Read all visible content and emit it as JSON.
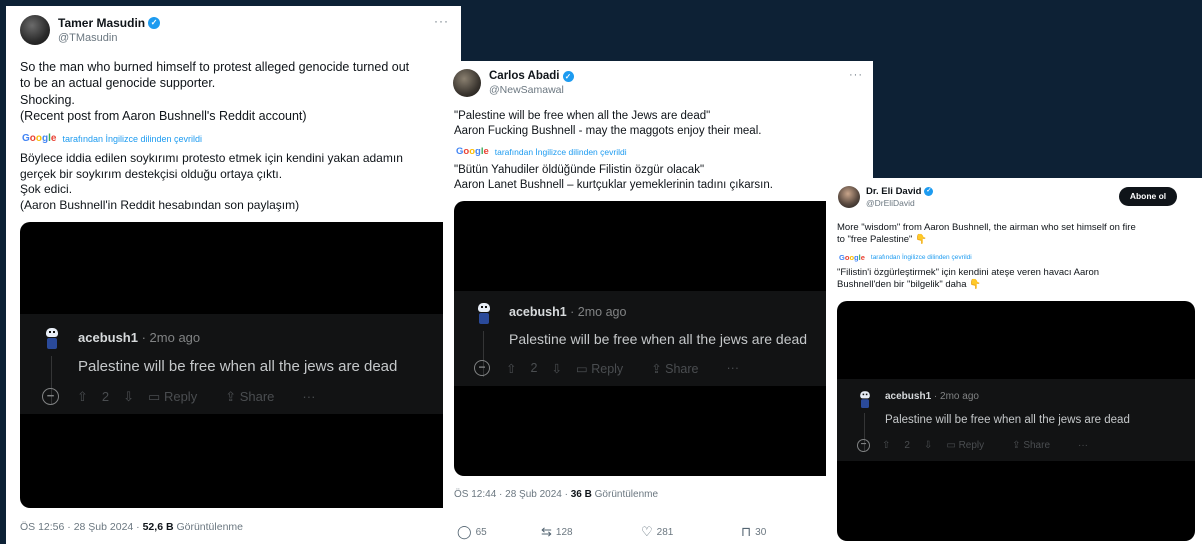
{
  "tweet1": {
    "author_name": "Tamer Masudin",
    "handle": "@TMasudin",
    "more": "···",
    "text_en": [
      "So the man who burned himself to protest alleged genocide turned out",
      "to be an actual genocide supporter.",
      "Shocking.",
      "(Recent post from Aaron Bushnell's Reddit account)"
    ],
    "translation_note": "tarafından İngilizce dilinden çevrildi",
    "text_tr": [
      "Böylece iddia edilen soykırımı protesto etmek için kendini yakan adamın",
      "gerçek bir soykırım destekçisi olduğu ortaya çıktı.",
      "Şok edici.",
      "(Aaron Bushnell'in Reddit hesabından son paylaşım)"
    ],
    "meta_prefix": "ÖS 12:56 · 28 Şub 2024 · ",
    "views": "52,6 B",
    "views_label": "Görüntülenme"
  },
  "tweet2": {
    "author_name": "Carlos Abadi",
    "handle": "@NewSamawal",
    "more": "···",
    "text_en": [
      "\"Palestine will be free when all the Jews are dead\"",
      "Aaron Fucking Bushnell - may the maggots enjoy their meal."
    ],
    "translation_note": "tarafından İngilizce dilinden çevrildi",
    "text_tr": [
      "\"Bütün Yahudiler öldüğünde Filistin özgür olacak\"",
      "Aaron Lanet Bushnell – kurtçuklar yemeklerinin tadını çıkarsın."
    ],
    "meta_prefix": "ÖS 12:44 · 28 Şub 2024 · ",
    "views": "36 B",
    "views_label": "Görüntülenme",
    "replies": "65",
    "reposts": "128",
    "likes": "281",
    "bookmarks": "30"
  },
  "tweet3": {
    "author_name": "Dr. Eli David",
    "handle": "@DrEliDavid",
    "follow_label": "Abone ol",
    "text_en": [
      "More \"wisdom\" from Aaron Bushnell, the airman who set himself on fire",
      "to \"free Palestine\" 👇"
    ],
    "translation_note": "tarafından İngilizce dilinden çevrildi",
    "text_tr": [
      "\"Filistin'i özgürleştirmek\" için kendini ateşe veren havacı Aaron",
      "Bushnell'den bir \"bilgelik\" daha 👇"
    ]
  },
  "google": "Google",
  "reddit": {
    "username": "acebush1",
    "time": " · 2mo ago",
    "comment": "Palestine will be free when all the jews are dead",
    "votes": "2",
    "reply": "Reply",
    "share": "Share",
    "more": "···",
    "collapse": "−"
  },
  "icons": {
    "verified": "verified-badge-icon",
    "reply": "reply-icon",
    "repost": "repost-icon",
    "like": "heart-icon",
    "bookmark": "bookmark-icon"
  },
  "colors": {
    "background": "#0d2135",
    "verified": "#1d9bf0",
    "reddit_bg": "#000000"
  }
}
